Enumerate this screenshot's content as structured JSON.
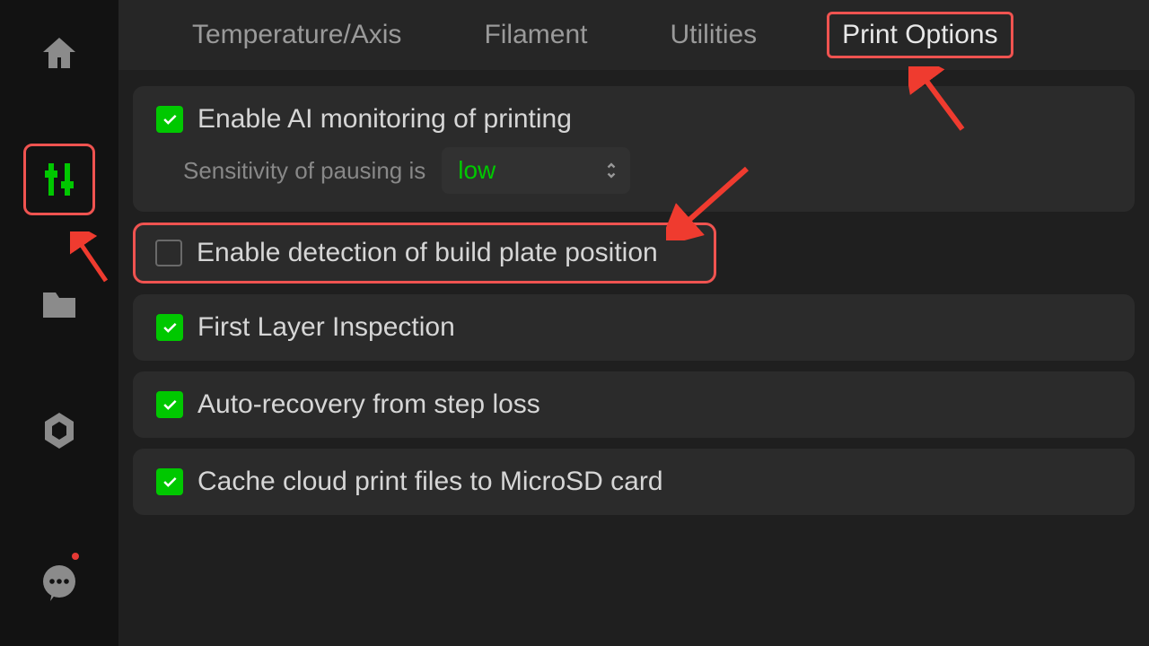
{
  "tabs": {
    "0": "Temperature/Axis",
    "1": "Filament",
    "2": "Utilities",
    "3": "Print Options"
  },
  "options": {
    "ai_monitoring": "Enable AI monitoring of printing",
    "sensitivity_label": "Sensitivity of pausing is",
    "sensitivity_value": "low",
    "build_plate": "Enable detection of build plate position",
    "first_layer": "First Layer Inspection",
    "auto_recovery": "Auto-recovery from step loss",
    "cache_cloud": "Cache cloud print files to MicroSD card"
  },
  "sidebar": {
    "home": "home",
    "settings": "settings",
    "files": "files",
    "system": "system",
    "chat": "chat"
  }
}
